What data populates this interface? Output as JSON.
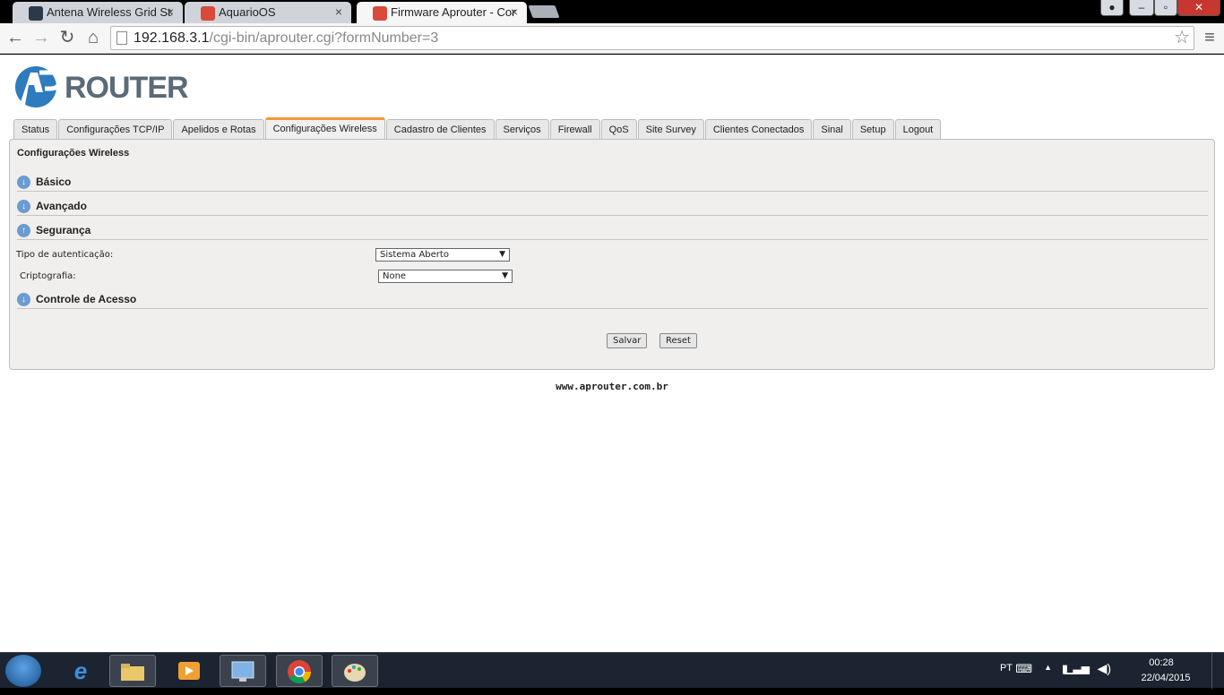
{
  "browser": {
    "tabs": [
      {
        "title": "Antena Wireless Grid Stati",
        "close": "×"
      },
      {
        "title": "AquarioOS",
        "close": "×"
      },
      {
        "title": "Firmware Aprouter - Conf",
        "close": "×"
      }
    ],
    "window_controls": {
      "minimize": "–",
      "maximize": "▫",
      "close": "✕"
    },
    "nav": {
      "back": "←",
      "forward": "→",
      "reload": "↻",
      "home": "⌂",
      "menu": "≡",
      "star": "☆"
    },
    "url": {
      "host": "192.168.3.1",
      "path": "/cgi-bin/aprouter.cgi?formNumber=3"
    }
  },
  "page": {
    "logo_text": "ROUTER",
    "nav_tabs": [
      "Status",
      "Configurações TCP/IP",
      "Apelidos e Rotas",
      "Configurações Wireless",
      "Cadastro de Clientes",
      "Serviços",
      "Firewall",
      "QoS",
      "Site Survey",
      "Clientes Conectados",
      "Sinal",
      "Setup",
      "Logout"
    ],
    "active_tab": "Configurações Wireless",
    "panel_title": "Configurações Wireless",
    "sections": {
      "basico": {
        "label": "Básico",
        "icon": "↓"
      },
      "avancado": {
        "label": "Avançado",
        "icon": "↓"
      },
      "seguranca": {
        "label": "Segurança",
        "icon": "↑"
      },
      "controle": {
        "label": "Controle de Acesso",
        "icon": "↓"
      }
    },
    "form": {
      "auth_label": "Tipo de autenticação:",
      "auth_value": "Sistema Aberto",
      "crypto_label": "Criptografia:",
      "crypto_value": "None",
      "arrow": "▼"
    },
    "buttons": {
      "save": "Salvar",
      "reset": "Reset"
    },
    "footer": "www.aprouter.com.br"
  },
  "taskbar": {
    "tray": {
      "language": "PT",
      "time": "00:28",
      "date": "22/04/2015"
    }
  },
  "colors": {
    "accent_tab": "#f29a38",
    "section_icon": "#6b9bd1",
    "logo": "#5b6a78",
    "logo_mark": "#2e7bbf"
  }
}
